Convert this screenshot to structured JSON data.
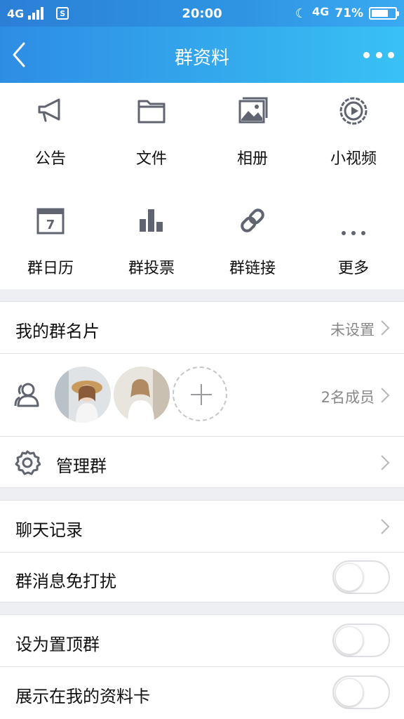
{
  "status_bar": {
    "network": "4G",
    "time": "20:00",
    "network2": "4G",
    "battery": "71%",
    "battery_level": 0.71
  },
  "header": {
    "title": "群资料"
  },
  "grid": [
    {
      "label": "公告",
      "icon": "megaphone-icon"
    },
    {
      "label": "文件",
      "icon": "folder-icon"
    },
    {
      "label": "相册",
      "icon": "photo-album-icon"
    },
    {
      "label": "小视频",
      "icon": "video-icon"
    },
    {
      "label": "群日历",
      "icon": "calendar-icon",
      "day": "7"
    },
    {
      "label": "群投票",
      "icon": "bar-chart-icon"
    },
    {
      "label": "群链接",
      "icon": "link-icon"
    },
    {
      "label": "更多",
      "icon": "more-dots-icon"
    }
  ],
  "card": {
    "label": "我的群名片",
    "value": "未设置"
  },
  "members": {
    "count_label": "2名成员"
  },
  "manage": {
    "label": "管理群"
  },
  "settings": {
    "chat_history": "聊天记录",
    "mute": "群消息免打扰",
    "pin_top": "设为置顶群",
    "show_on_card": "展示在我的资料卡"
  },
  "colors": {
    "accent": "#2f95e3",
    "icon_gray": "#5f6470"
  }
}
